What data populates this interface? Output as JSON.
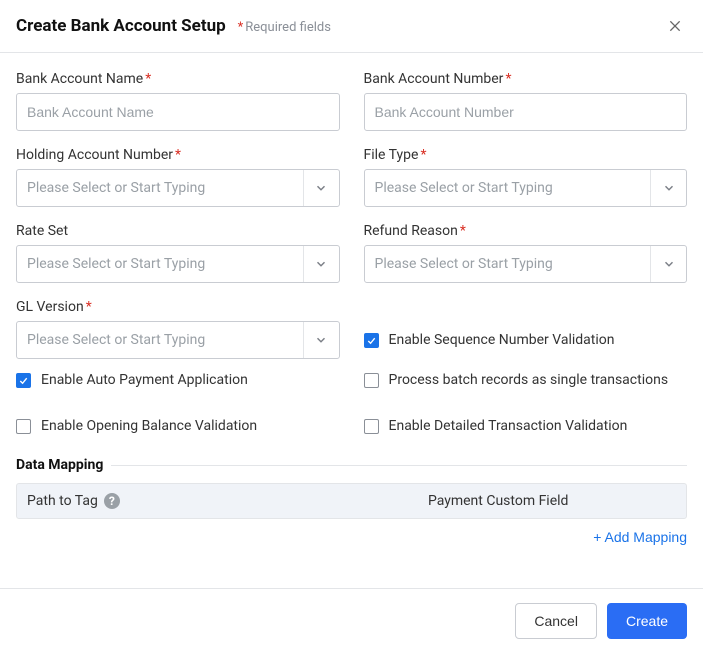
{
  "header": {
    "title": "Create Bank Account Setup",
    "required_hint": "Required fields"
  },
  "fields": {
    "bank_account_name": {
      "label": "Bank Account Name",
      "placeholder": "Bank Account Name",
      "required": true
    },
    "bank_account_number": {
      "label": "Bank Account Number",
      "placeholder": "Bank Account Number",
      "required": true
    },
    "holding_account_number": {
      "label": "Holding Account Number",
      "placeholder": "Please Select or Start Typing",
      "required": true
    },
    "file_type": {
      "label": "File Type",
      "placeholder": "Please Select or Start Typing",
      "required": true
    },
    "rate_set": {
      "label": "Rate Set",
      "placeholder": "Please Select or Start Typing",
      "required": false
    },
    "refund_reason": {
      "label": "Refund Reason",
      "placeholder": "Please Select or Start Typing",
      "required": true
    },
    "gl_version": {
      "label": "GL Version",
      "placeholder": "Please Select or Start Typing",
      "required": true
    }
  },
  "checks": {
    "enable_sequence_validation": {
      "label": "Enable Sequence Number Validation",
      "checked": true
    },
    "enable_auto_payment": {
      "label": "Enable Auto Payment Application",
      "checked": true
    },
    "process_batch_single": {
      "label": "Process batch records as single transactions",
      "checked": false
    },
    "enable_opening_balance": {
      "label": "Enable Opening Balance Validation",
      "checked": false
    },
    "enable_detailed_tx": {
      "label": "Enable Detailed Transaction Validation",
      "checked": false
    }
  },
  "data_mapping": {
    "section_title": "Data Mapping",
    "col_path_to_tag": "Path to Tag",
    "col_payment_custom_field": "Payment Custom Field",
    "add_link": "+ Add Mapping"
  },
  "footer": {
    "cancel": "Cancel",
    "create": "Create"
  }
}
